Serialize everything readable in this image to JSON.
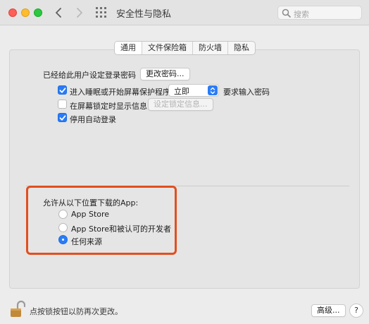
{
  "window": {
    "title": "安全性与隐私",
    "search_placeholder": "搜索"
  },
  "tabs": [
    {
      "label": "通用",
      "active": true
    },
    {
      "label": "文件保险箱",
      "active": false
    },
    {
      "label": "防火墙",
      "active": false
    },
    {
      "label": "隐私",
      "active": false
    }
  ],
  "general": {
    "password_set_label": "已经给此用户设定登录密码",
    "change_password_button": "更改密码...",
    "require_password": {
      "checked": true,
      "label": "进入睡眠或开始屏幕保护程序",
      "delay_value": "立即",
      "suffix": "要求输入密码"
    },
    "show_message": {
      "checked": false,
      "label": "在屏幕锁定时显示信息",
      "button": "设定锁定信息..."
    },
    "disable_autologin": {
      "checked": true,
      "label": "停用自动登录"
    }
  },
  "app_download": {
    "heading": "允许从以下位置下载的App:",
    "options": [
      {
        "label": "App Store",
        "selected": false
      },
      {
        "label": "App Store和被认可的开发者",
        "selected": false
      },
      {
        "label": "任何来源",
        "selected": true
      }
    ]
  },
  "footer": {
    "lock_text": "点按锁按钮以防再次更改。",
    "advanced_button": "高级...",
    "help_button": "?"
  },
  "colors": {
    "accent": "#2a7cf6",
    "highlight": "#e14f1f"
  }
}
